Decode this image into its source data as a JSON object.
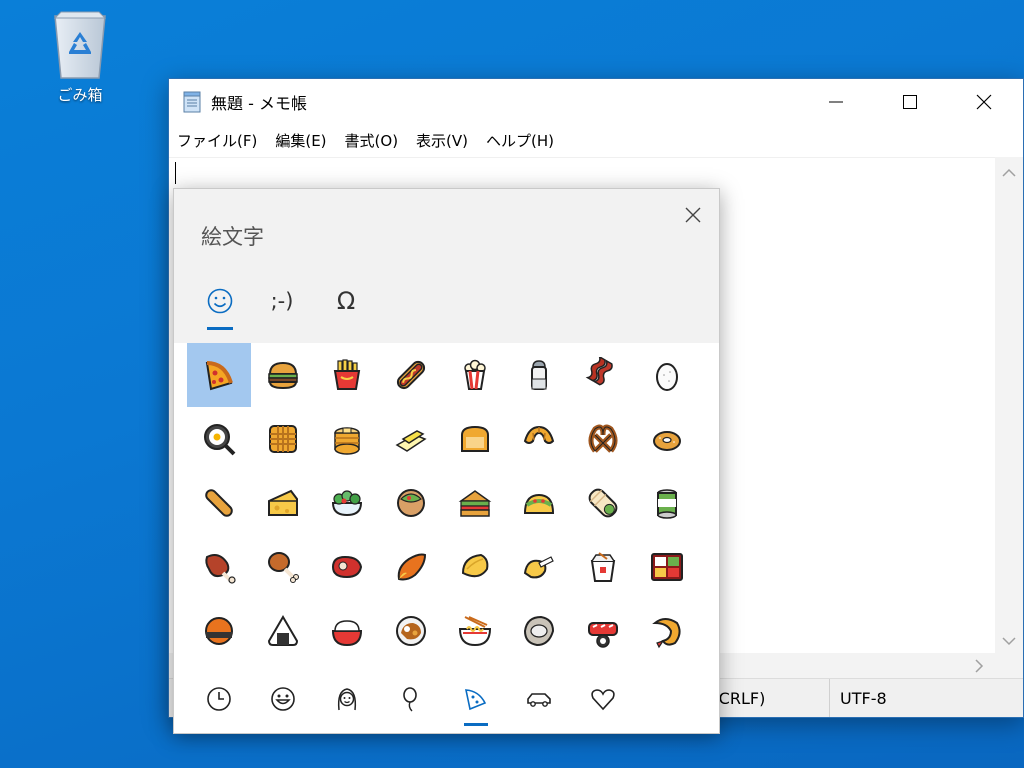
{
  "desktop": {
    "recycle_bin_label": "ごみ箱"
  },
  "notepad": {
    "title": "無題 - メモ帳",
    "menu": [
      "ファイル(F)",
      "編集(E)",
      "書式(O)",
      "表示(V)",
      "ヘルプ(H)"
    ],
    "status": {
      "line_ending": "s (CRLF)",
      "encoding": "UTF-8"
    }
  },
  "emoji_panel": {
    "title": "絵文字",
    "tabs": [
      {
        "name": "emoji",
        "glyph": "☺"
      },
      {
        "name": "kaomoji",
        "glyph": ";-)"
      },
      {
        "name": "symbols",
        "glyph": "Ω"
      }
    ],
    "grid": [
      [
        "pizza",
        "hamburger",
        "fries",
        "hotdog",
        "popcorn",
        "salt",
        "bacon",
        "egg"
      ],
      [
        "cooking",
        "waffle",
        "pancakes",
        "butter",
        "bread",
        "croissant",
        "pretzel",
        "bagel"
      ],
      [
        "baguette",
        "cheese",
        "salad",
        "stuffed-flatbread",
        "sandwich",
        "taco",
        "burrito",
        "canned-food"
      ],
      [
        "meat-on-bone",
        "poultry-leg",
        "cut-of-meat",
        "roasted-sweet-potato",
        "dumpling",
        "fortune-cookie",
        "takeout-box",
        "bento"
      ],
      [
        "rice-cracker",
        "rice-ball",
        "cooked-rice",
        "curry-rice",
        "ramen",
        "oyster",
        "sushi",
        "fried-shrimp"
      ]
    ],
    "selected": "pizza",
    "categories": [
      "clock-icon",
      "smiley-icon",
      "person-icon",
      "balloon-icon",
      "pizza-icon",
      "car-icon",
      "heart-icon"
    ],
    "active_category": "pizza-icon",
    "colors": {
      "accent": "#0a6cc2",
      "selection": "#a3c8ef"
    }
  }
}
